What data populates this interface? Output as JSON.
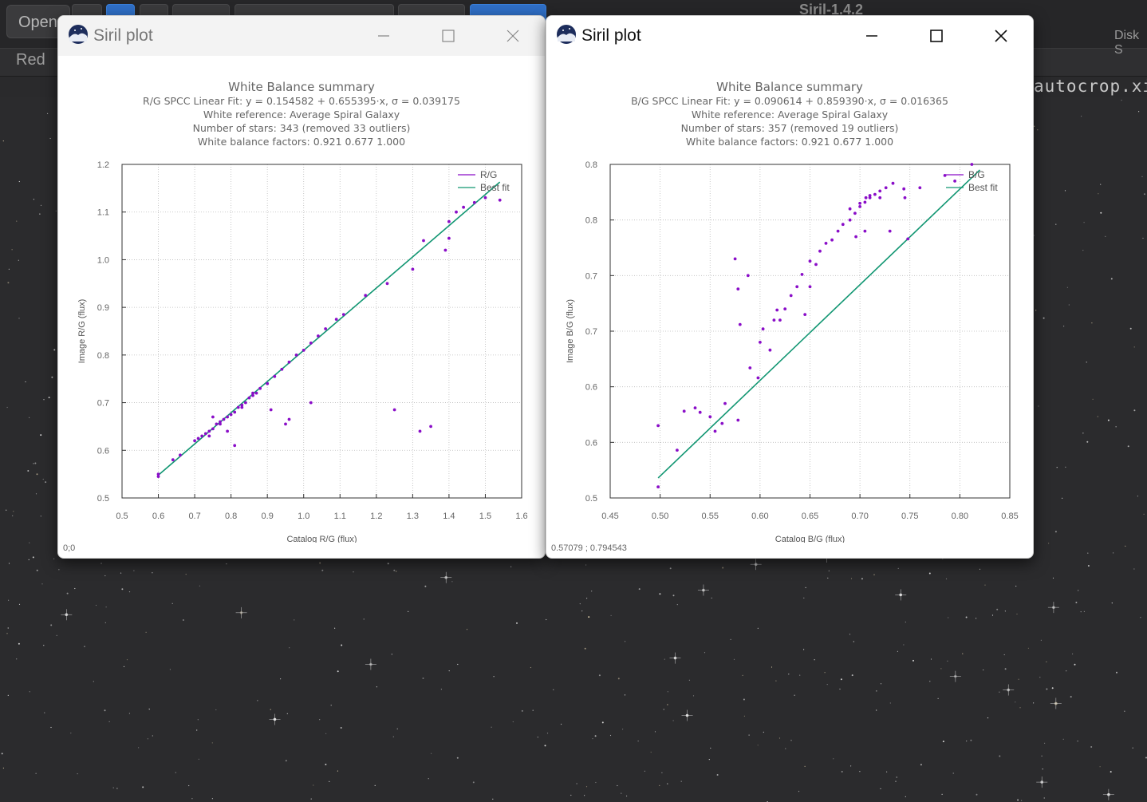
{
  "background": {
    "open_button": "Open",
    "channel_label": "Red",
    "app_title": "Siril-1.4.2",
    "disk_label": "Disk S",
    "file_label": "autocrop.xi"
  },
  "windows": [
    {
      "title": "Siril plot",
      "status": "0;0",
      "chart_data": {
        "type": "scatter",
        "title": "White Balance summary",
        "subtitle_lines": [
          "R/G SPCC Linear Fit: y = 0.154582 + 0.655395·x, σ = 0.039175",
          "White reference: Average Spiral Galaxy",
          "Number of stars: 343 (removed 33 outliers)",
          "White balance factors: 0.921 0.677 1.000"
        ],
        "xlabel": "Catalog R/G (flux)",
        "ylabel": "Image R/G (flux)",
        "xlim": [
          0.5,
          1.6
        ],
        "ylim": [
          0.5,
          1.2
        ],
        "xticks": [
          "0.5",
          "0.6",
          "0.7",
          "0.8",
          "0.9",
          "1.0",
          "1.1",
          "1.2",
          "1.3",
          "1.4",
          "1.5",
          "1.6"
        ],
        "yticks": [
          "0.5",
          "0.6",
          "0.7",
          "0.8",
          "0.9",
          "1.0",
          "1.1",
          "1.2"
        ],
        "grid": true,
        "legend_position": "top-right",
        "legend": [
          "R/G",
          "Best fit"
        ],
        "fit_line": {
          "x": [
            0.6,
            1.54
          ],
          "y": [
            0.548,
            1.163
          ]
        },
        "series": [
          {
            "name": "R/G",
            "color": "#8a0ec8",
            "points": [
              [
                0.6,
                0.55
              ],
              [
                0.6,
                0.545
              ],
              [
                0.64,
                0.58
              ],
              [
                0.66,
                0.59
              ],
              [
                0.7,
                0.62
              ],
              [
                0.71,
                0.625
              ],
              [
                0.72,
                0.63
              ],
              [
                0.73,
                0.635
              ],
              [
                0.74,
                0.64
              ],
              [
                0.75,
                0.645
              ],
              [
                0.76,
                0.655
              ],
              [
                0.77,
                0.66
              ],
              [
                0.78,
                0.665
              ],
              [
                0.79,
                0.67
              ],
              [
                0.8,
                0.675
              ],
              [
                0.81,
                0.68
              ],
              [
                0.82,
                0.69
              ],
              [
                0.83,
                0.695
              ],
              [
                0.84,
                0.7
              ],
              [
                0.85,
                0.71
              ],
              [
                0.86,
                0.715
              ],
              [
                0.87,
                0.72
              ],
              [
                0.88,
                0.73
              ],
              [
                0.9,
                0.74
              ],
              [
                0.92,
                0.755
              ],
              [
                0.94,
                0.77
              ],
              [
                0.96,
                0.785
              ],
              [
                0.98,
                0.8
              ],
              [
                1.0,
                0.81
              ],
              [
                1.02,
                0.825
              ],
              [
                1.04,
                0.84
              ],
              [
                1.06,
                0.855
              ],
              [
                1.09,
                0.875
              ],
              [
                1.11,
                0.885
              ],
              [
                1.17,
                0.925
              ],
              [
                1.23,
                0.95
              ],
              [
                1.3,
                0.98
              ],
              [
                1.33,
                1.04
              ],
              [
                1.4,
                1.045
              ],
              [
                1.4,
                1.08
              ],
              [
                1.42,
                1.1
              ],
              [
                1.44,
                1.11
              ],
              [
                1.47,
                1.12
              ],
              [
                1.5,
                1.13
              ],
              [
                1.54,
                1.125
              ],
              [
                1.39,
                1.02
              ],
              [
                0.95,
                0.655
              ],
              [
                0.96,
                0.665
              ],
              [
                1.02,
                0.7
              ],
              [
                0.91,
                0.685
              ],
              [
                1.25,
                0.685
              ],
              [
                1.32,
                0.64
              ],
              [
                1.35,
                0.65
              ],
              [
                0.81,
                0.61
              ],
              [
                0.74,
                0.63
              ],
              [
                0.77,
                0.655
              ],
              [
                0.79,
                0.64
              ],
              [
                0.86,
                0.72
              ],
              [
                0.75,
                0.67
              ],
              [
                0.83,
                0.69
              ]
            ]
          }
        ]
      }
    },
    {
      "title": "Siril plot",
      "status": "0.57079 ;   0.794543",
      "chart_data": {
        "type": "scatter",
        "title": "White Balance summary",
        "subtitle_lines": [
          "B/G SPCC Linear Fit: y = 0.090614 + 0.859390·x, σ = 0.016365",
          "White reference: Average Spiral Galaxy",
          "Number of stars: 357 (removed 19 outliers)",
          "White balance factors: 0.921 0.677 1.000"
        ],
        "xlabel": "Catalog B/G (flux)",
        "ylabel": "Image B/G (flux)",
        "xlim": [
          0.45,
          0.85
        ],
        "ylim": [
          0.5,
          0.8
        ],
        "xticks": [
          "0.45",
          "0.50",
          "0.55",
          "0.60",
          "0.65",
          "0.70",
          "0.75",
          "0.80",
          "0.85"
        ],
        "yticks": [
          "0.5",
          "0.6",
          "0.6",
          "0.7",
          "0.7",
          "0.8",
          "0.8"
        ],
        "grid": true,
        "legend_position": "top-right",
        "legend": [
          "B/G",
          "Best fit"
        ],
        "fit_line": {
          "x": [
            0.498,
            0.82
          ],
          "y": [
            0.518,
            0.795
          ]
        },
        "series": [
          {
            "name": "B/G",
            "color": "#8a0ec8",
            "points": [
              [
                0.498,
                0.565
              ],
              [
                0.498,
                0.51
              ],
              [
                0.517,
                0.543
              ],
              [
                0.524,
                0.578
              ],
              [
                0.535,
                0.581
              ],
              [
                0.54,
                0.577
              ],
              [
                0.55,
                0.573
              ],
              [
                0.555,
                0.56
              ],
              [
                0.562,
                0.567
              ],
              [
                0.565,
                0.585
              ],
              [
                0.578,
                0.57
              ],
              [
                0.58,
                0.656
              ],
              [
                0.578,
                0.688
              ],
              [
                0.59,
                0.617
              ],
              [
                0.598,
                0.608
              ],
              [
                0.6,
                0.64
              ],
              [
                0.603,
                0.652
              ],
              [
                0.61,
                0.633
              ],
              [
                0.614,
                0.66
              ],
              [
                0.617,
                0.669
              ],
              [
                0.625,
                0.67
              ],
              [
                0.631,
                0.682
              ],
              [
                0.637,
                0.69
              ],
              [
                0.642,
                0.701
              ],
              [
                0.65,
                0.713
              ],
              [
                0.656,
                0.71
              ],
              [
                0.66,
                0.722
              ],
              [
                0.666,
                0.729
              ],
              [
                0.672,
                0.732
              ],
              [
                0.678,
                0.74
              ],
              [
                0.683,
                0.746
              ],
              [
                0.69,
                0.75
              ],
              [
                0.695,
                0.756
              ],
              [
                0.7,
                0.762
              ],
              [
                0.705,
                0.766
              ],
              [
                0.71,
                0.77
              ],
              [
                0.715,
                0.773
              ],
              [
                0.72,
                0.776
              ],
              [
                0.726,
                0.779
              ],
              [
                0.733,
                0.783
              ],
              [
                0.744,
                0.778
              ],
              [
                0.76,
                0.779
              ],
              [
                0.785,
                0.79
              ],
              [
                0.795,
                0.785
              ],
              [
                0.812,
                0.8
              ],
              [
                0.745,
                0.77
              ],
              [
                0.69,
                0.76
              ],
              [
                0.706,
                0.77
              ],
              [
                0.73,
                0.74
              ],
              [
                0.705,
                0.74
              ],
              [
                0.65,
                0.69
              ],
              [
                0.645,
                0.665
              ],
              [
                0.62,
                0.66
              ],
              [
                0.588,
                0.7
              ],
              [
                0.575,
                0.715
              ],
              [
                0.7,
                0.765
              ],
              [
                0.71,
                0.772
              ],
              [
                0.72,
                0.77
              ],
              [
                0.696,
                0.735
              ],
              [
                0.748,
                0.733
              ]
            ]
          }
        ]
      }
    }
  ]
}
